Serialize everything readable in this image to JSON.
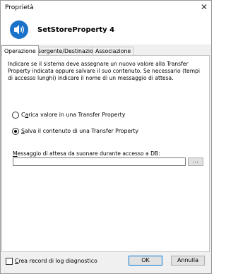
{
  "window": {
    "title": "Proprietà",
    "close_glyph": "✕"
  },
  "header": {
    "icon": "speaker-icon",
    "title": "SetStoreProperty 4"
  },
  "tabs": [
    {
      "label": "Operazione",
      "active": true
    },
    {
      "label": "Sorgente/Destinazione",
      "active": false
    },
    {
      "label": "Associazione",
      "active": false
    }
  ],
  "operazione": {
    "description": "Indicare se il sistema deve assegnare un nuovo valore alla Transfer Property indicata oppure salvare il suo contenuto. Se necessario (tempi di accesso lunghi) indicare il nome di un messaggio di attesa.",
    "radio_load": {
      "label_first": "C",
      "label_under": "a",
      "label_rest": "rica valore in una Transfer Property",
      "selected": false
    },
    "radio_save": {
      "label_first": "",
      "label_under": "S",
      "label_rest": "alva il contenuto di una Transfer Property",
      "selected": true
    },
    "wait_message": {
      "label_first": "",
      "label_under": "M",
      "label_rest": "essaggio di attesa da suonare durante accesso a DB:",
      "value": "",
      "browse_label": "..."
    }
  },
  "footer": {
    "log_checkbox": {
      "label_first": "",
      "label_under": "C",
      "label_rest": "rea record di log diagnostico",
      "checked": false
    },
    "ok_label": "OK",
    "cancel_label": "Annulla"
  },
  "colors": {
    "accent": "#0078d7",
    "icon_blue": "#1a73c8"
  }
}
